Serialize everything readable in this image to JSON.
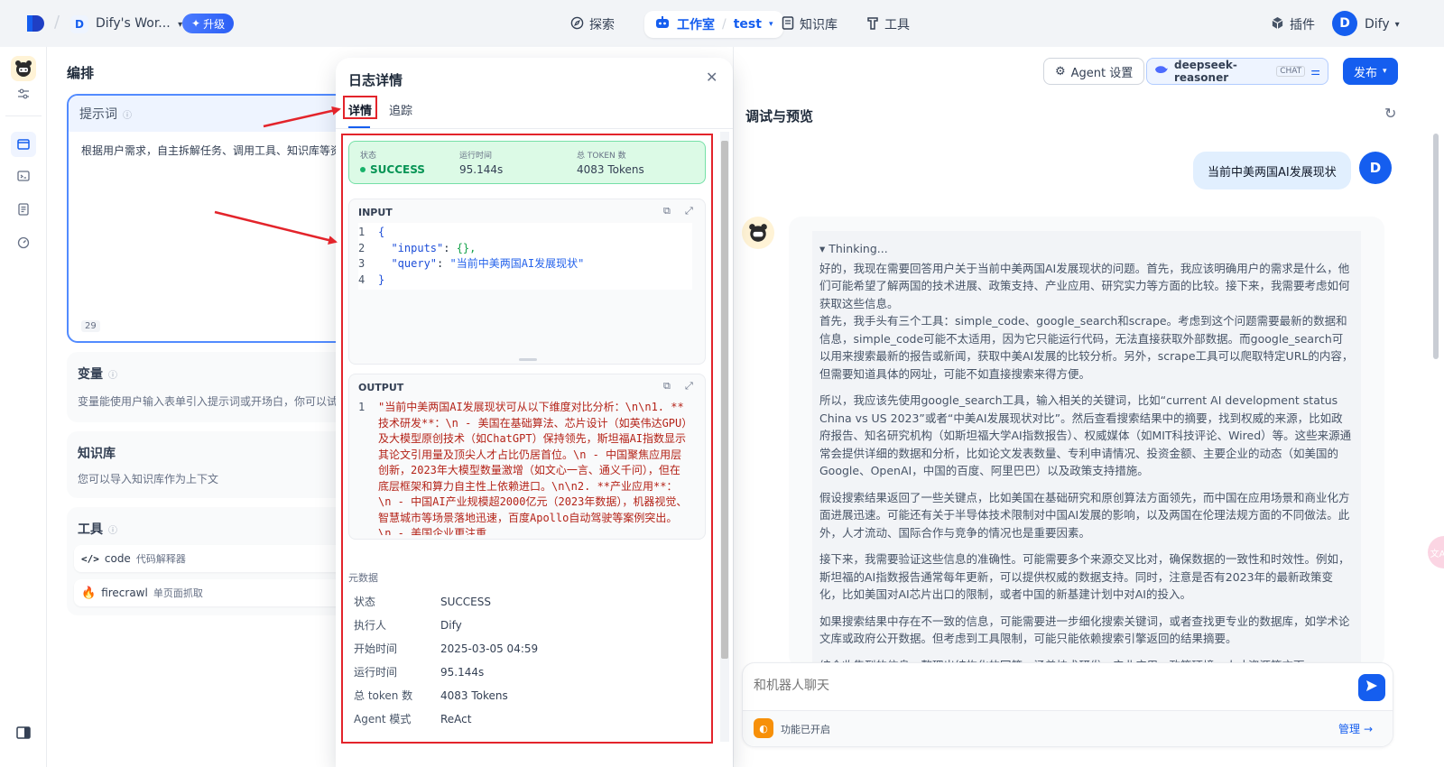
{
  "topbar": {
    "workspace_initial": "D",
    "workspace_name": "Dify's Wor...",
    "upgrade_label": "升级",
    "nav_explore": "探索",
    "nav_studio": "工作室",
    "nav_app": "test",
    "nav_knowledge": "知识库",
    "nav_tools": "工具",
    "plugins": "插件",
    "user_initial": "D",
    "user_name": "Dify"
  },
  "orchestrate": {
    "title": "编排",
    "prompt_label": "提示词",
    "prompt_text": "根据用户需求，自主拆解任务、调用工具、知识库等资",
    "prompt_count": "29",
    "vars_label": "变量",
    "vars_desc": "变量能使用户输入表单引入提示词或开场白，你可以试试在",
    "kb_label": "知识库",
    "kb_desc": "您可以导入知识库作为上下文",
    "tools_label": "工具",
    "tools": [
      {
        "name": "code",
        "desc": "代码解释器"
      },
      {
        "name": "firecrawl",
        "desc": "单页面抓取"
      }
    ]
  },
  "header_right": {
    "agent_settings": "Agent 设置",
    "model_name": "deepseek-reasoner",
    "model_mode": "CHAT",
    "publish": "发布"
  },
  "log": {
    "title": "日志详情",
    "tab_detail": "详情",
    "tab_trace": "追踪",
    "status_label": "状态",
    "status_value": "SUCCESS",
    "runtime_label": "运行时间",
    "runtime_value": "95.144s",
    "tokens_label": "总 TOKEN 数",
    "tokens_value": "4083 Tokens",
    "input_label": "INPUT",
    "input_lines": [
      "1",
      "2",
      "3",
      "4"
    ],
    "input_code": {
      "open": "{",
      "inputs_key": "\"inputs\"",
      "inputs_val": "{},",
      "query_key": "\"query\"",
      "query_val": "\"当前中美两国AI发展现状\"",
      "close": "}"
    },
    "output_label": "OUTPUT",
    "output_line_no": "1",
    "output_text": "\"当前中美两国AI发展现状可从以下维度对比分析：\\n\\n1. **技术研发**：\\n   - 美国在基础算法、芯片设计（如英伟达GPU）及大模型原创技术（如ChatGPT）保持领先，斯坦福AI指数显示其论文引用量及顶尖人才占比仍居首位。\\n   - 中国聚焦应用层创新，2023年大模型数量激增（如文心一言、通义千问），但在底层框架和算力自主性上依赖进口。\\n\\n2. **产业应用**：\\n   - 中国AI产业规模超2000亿元（2023年数据），机器视觉、智慧城市等场景落地迅速，百度Apollo自动驾驶等案例突出。\\n   - 美国企业更注重",
    "metadata_label": "元数据",
    "meta": [
      {
        "k": "状态",
        "v": "SUCCESS"
      },
      {
        "k": "执行人",
        "v": "Dify"
      },
      {
        "k": "开始时间",
        "v": "2025-03-05 04:59"
      },
      {
        "k": "运行时间",
        "v": "95.144s"
      },
      {
        "k": "总 token 数",
        "v": "4083 Tokens"
      },
      {
        "k": "Agent 模式",
        "v": "ReAct"
      }
    ]
  },
  "preview": {
    "title": "调试与预览",
    "user_initial": "D",
    "user_message": "当前中美两国AI发展现状",
    "thinking_label": "▾ Thinking...",
    "thinking_paragraphs": [
      "好的，我现在需要回答用户关于当前中美两国AI发展现状的问题。首先，我应该明确用户的需求是什么，他们可能希望了解两国的技术进展、政策支持、产业应用、研究实力等方面的比较。接下来，我需要考虑如何获取这些信息。\n首先，我手头有三个工具：simple_code、google_search和scrape。考虑到这个问题需要最新的数据和信息，simple_code可能不太适用，因为它只能运行代码，无法直接获取外部数据。而google_search可以用来搜索最新的报告或新闻，获取中美AI发展的比较分析。另外，scrape工具可以爬取特定URL的内容，但需要知道具体的网址，可能不如直接搜索来得方便。",
      "所以，我应该先使用google_search工具，输入相关的关键词，比如“current AI development status China vs US 2023”或者“中美AI发展现状对比”。然后查看搜索结果中的摘要，找到权威的来源，比如政府报告、知名研究机构（如斯坦福大学AI指数报告）、权威媒体（如MIT科技评论、Wired）等。这些来源通常会提供详细的数据和分析，比如论文发表数量、专利申请情况、投资金额、主要企业的动态（如美国的Google、OpenAI，中国的百度、阿里巴巴）以及政策支持措施。",
      "假设搜索结果返回了一些关键点，比如美国在基础研究和原创算法方面领先，而中国在应用场景和商业化方面进展迅速。可能还有关于半导体技术限制对中国AI发展的影响，以及两国在伦理法规方面的不同做法。此外，人才流动、国际合作与竞争的情况也是重要因素。",
      "接下来，我需要验证这些信息的准确性。可能需要多个来源交叉比对，确保数据的一致性和时效性。例如，斯坦福的AI指数报告通常每年更新，可以提供权威的数据支持。同时，注意是否有2023年的最新政策变化，比如美国对AI芯片出口的限制，或者中国的新基建计划中对AI的投入。",
      "如果搜索结果中存在不一致的信息，可能需要进一步细化搜索关键词，或者查找更专业的数据库，如学术论文库或政府公开数据。但考虑到工具限制，可能只能依赖搜索引擎返回的结果摘要。",
      "综合收集到的信息，整理出结构化的回答，涵盖技术研发、产业应用、政策环境、人才资源等方面"
    ],
    "input_placeholder": "和机器人聊天",
    "feature_enabled": "功能已开启",
    "manage": "管理"
  },
  "colors": {
    "accent": "#155eef",
    "success": "#17b26a",
    "annotation": "#e3242b"
  }
}
